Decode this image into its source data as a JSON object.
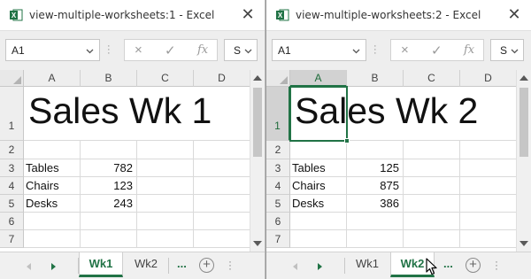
{
  "colors": {
    "excel_green": "#217346",
    "select_header": "#d2d2d2"
  },
  "windows": [
    {
      "title": "view-multiple-worksheets:1 - Excel",
      "name_box": "A1",
      "formula_icons": [
        "×",
        "✓",
        "fx"
      ],
      "font_box": "S",
      "columns": [
        "A",
        "B",
        "C",
        "D"
      ],
      "rows": [
        "1",
        "2",
        "3",
        "4",
        "5",
        "6",
        "7"
      ],
      "heading": "Sales Wk 1",
      "items": [
        {
          "label": "Tables",
          "value": "782"
        },
        {
          "label": "Chairs",
          "value": "123"
        },
        {
          "label": "Desks",
          "value": "243"
        }
      ],
      "tabs": [
        "Wk1",
        "Wk2"
      ],
      "active_tab": "Wk1",
      "more": "...",
      "add": "+"
    },
    {
      "title": "view-multiple-worksheets:2 - Excel",
      "name_box": "A1",
      "formula_icons": [
        "×",
        "✓",
        "fx"
      ],
      "font_box": "S",
      "columns": [
        "A",
        "B",
        "C",
        "D"
      ],
      "rows": [
        "1",
        "2",
        "3",
        "4",
        "5",
        "6",
        "7"
      ],
      "heading": "Sales Wk 2",
      "items": [
        {
          "label": "Tables",
          "value": "125"
        },
        {
          "label": "Chairs",
          "value": "875"
        },
        {
          "label": "Desks",
          "value": "386"
        }
      ],
      "tabs": [
        "Wk1",
        "Wk2"
      ],
      "active_tab": "Wk2",
      "more": "...",
      "add": "+"
    }
  ]
}
